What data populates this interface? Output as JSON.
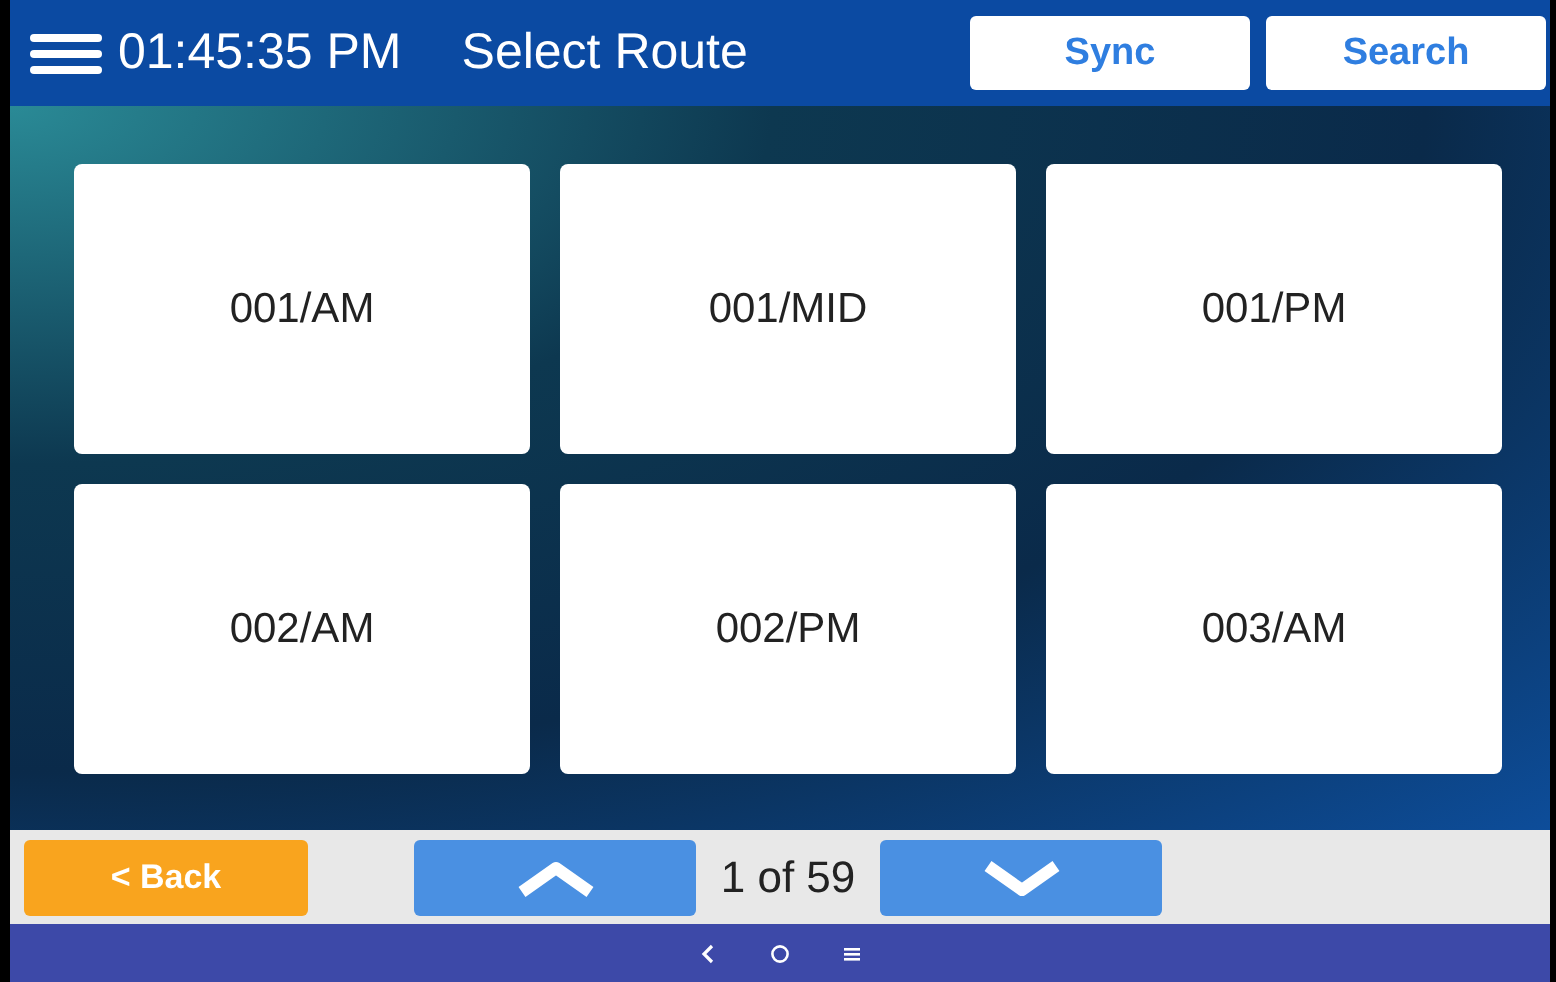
{
  "header": {
    "clock": "01:45:35 PM",
    "title": "Select Route",
    "buttons": [
      "Sync",
      "Search"
    ]
  },
  "routes": [
    {
      "label": "001/AM"
    },
    {
      "label": "001/MID"
    },
    {
      "label": "001/PM"
    },
    {
      "label": "002/AM"
    },
    {
      "label": "002/PM"
    },
    {
      "label": "003/AM"
    }
  ],
  "footer": {
    "back": "< Back",
    "page": "1 of 59"
  }
}
